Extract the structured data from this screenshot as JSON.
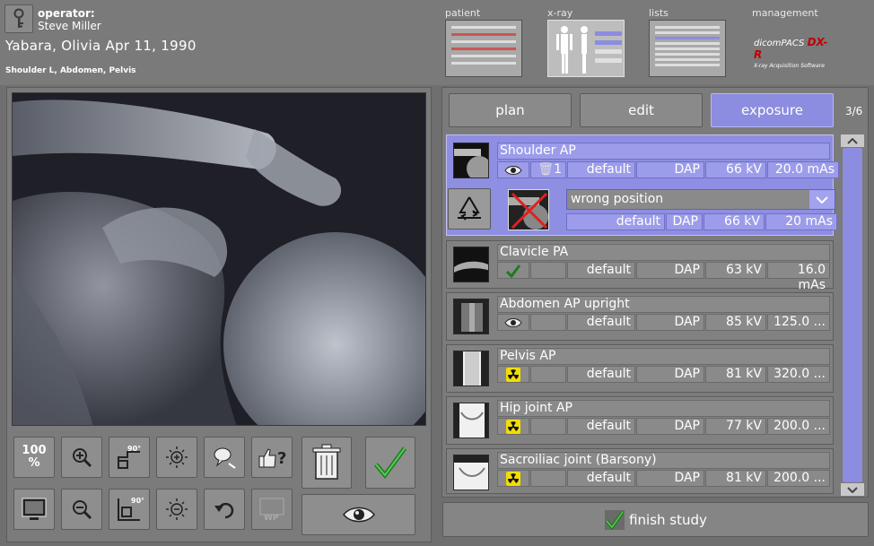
{
  "operator": {
    "label": "operator:",
    "name": "Steve Miller"
  },
  "patient": {
    "name": "Yabara,  Olivia  Apr 11, 1990"
  },
  "exam_description": "Shoulder L, Abdomen, Pelvis",
  "nav_tabs": [
    {
      "label": "patient",
      "icon": "patient-screen-thumbnail"
    },
    {
      "label": "x-ray",
      "icon": "body-figure-thumbnail",
      "selected": true
    },
    {
      "label": "lists",
      "icon": "lists-screen-thumbnail"
    },
    {
      "label": "management",
      "icon": "dicompacs-logo"
    }
  ],
  "logo": {
    "line1": "dicomPACS",
    "line2": "DX-R",
    "line3": "X-ray Acquisition Software",
    "accent": "#c00000"
  },
  "tools": {
    "row1": [
      {
        "name": "zoom-100-button",
        "label": "100\n%"
      },
      {
        "name": "zoom-in-button",
        "icon": "magnifier-plus-icon"
      },
      {
        "name": "rotate-90-button",
        "label": "90°"
      },
      {
        "name": "brightness-up-button",
        "icon": "sun-plus-icon"
      },
      {
        "name": "annotation-button",
        "icon": "speech-bubble-icon"
      },
      {
        "name": "quality-rating-button",
        "icon": "thumb-question-icon"
      }
    ],
    "row2": [
      {
        "name": "fit-screen-button",
        "icon": "monitor-icon"
      },
      {
        "name": "zoom-out-button",
        "icon": "magnifier-minus-icon"
      },
      {
        "name": "rotate-flip-button",
        "label": "90°"
      },
      {
        "name": "brightness-down-button",
        "icon": "sun-minus-icon"
      },
      {
        "name": "undo-button",
        "icon": "undo-arrow-icon"
      },
      {
        "name": "wp-button",
        "label": "WP"
      }
    ],
    "trash_icon": "trash-icon",
    "accept_icon": "checkmark-icon",
    "preview_icon": "eye-icon"
  },
  "segments": [
    {
      "label": "plan",
      "active": false
    },
    {
      "label": "edit",
      "active": false
    },
    {
      "label": "exposure",
      "active": true
    }
  ],
  "counter": "3/6",
  "exams": [
    {
      "title": "Shoulder AP",
      "status": "eye",
      "count": "1",
      "preset": "default",
      "dose": "DAP",
      "kv": "66 kV",
      "mas": "20.0 mAs",
      "selected": true
    },
    {
      "title": "Clavicle PA",
      "status": "check",
      "count": "",
      "preset": "default",
      "dose": "DAP",
      "kv": "63 kV",
      "mas": "16.0 mAs"
    },
    {
      "title": "Abdomen AP upright",
      "status": "eye",
      "count": "",
      "preset": "default",
      "dose": "DAP",
      "kv": "85 kV",
      "mas": "125.0 ..."
    },
    {
      "title": "Pelvis AP",
      "status": "radiation",
      "count": "",
      "preset": "default",
      "dose": "DAP",
      "kv": "81 kV",
      "mas": "320.0 ..."
    },
    {
      "title": "Hip joint AP",
      "status": "radiation",
      "count": "",
      "preset": "default",
      "dose": "DAP",
      "kv": "77 kV",
      "mas": "200.0 ..."
    },
    {
      "title": "Sacroiliac joint (Barsony)",
      "status": "radiation",
      "count": "",
      "preset": "default",
      "dose": "DAP",
      "kv": "81 kV",
      "mas": "200.0 ..."
    }
  ],
  "rejection": {
    "reason": "wrong position",
    "preset": "default",
    "dose": "DAP",
    "kv": "66 kV",
    "mas": "20 mAs"
  },
  "finish": {
    "label": "finish study"
  },
  "colors": {
    "accent": "#8c8ce0",
    "panel": "#7b7b7b",
    "radiation": "#f2dd00"
  }
}
